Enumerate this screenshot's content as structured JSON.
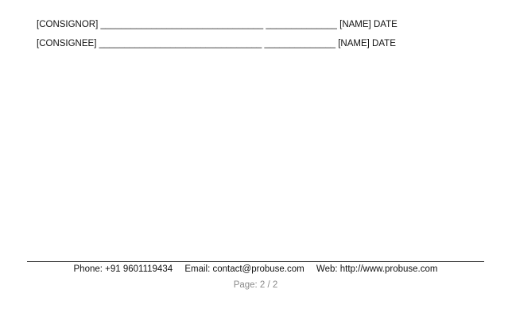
{
  "signatures": {
    "consignor": {
      "label": "[CONSIGNOR]",
      "sign_blank": "________________________________",
      "date_blank": "______________",
      "name_date": "[NAME] DATE"
    },
    "consignee": {
      "label": "[CONSIGNEE]",
      "sign_blank": "________________________________",
      "date_blank": "______________",
      "name_date": "[NAME] DATE"
    }
  },
  "footer": {
    "phone": "Phone: +91 9601119434",
    "email": "Email: contact@probuse.com",
    "web": "Web: http://www.probuse.com",
    "page": "Page: 2 / 2"
  }
}
